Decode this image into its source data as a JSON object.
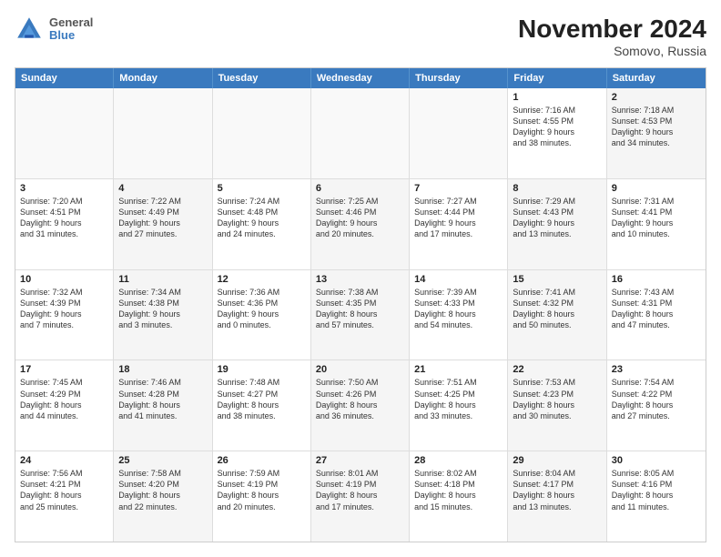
{
  "header": {
    "logo": {
      "line1": "General",
      "line2": "Blue"
    },
    "title": "November 2024",
    "subtitle": "Somovo, Russia"
  },
  "weekdays": [
    "Sunday",
    "Monday",
    "Tuesday",
    "Wednesday",
    "Thursday",
    "Friday",
    "Saturday"
  ],
  "rows": [
    [
      {
        "day": "",
        "info": "",
        "shaded": false,
        "empty": true
      },
      {
        "day": "",
        "info": "",
        "shaded": false,
        "empty": true
      },
      {
        "day": "",
        "info": "",
        "shaded": false,
        "empty": true
      },
      {
        "day": "",
        "info": "",
        "shaded": false,
        "empty": true
      },
      {
        "day": "",
        "info": "",
        "shaded": false,
        "empty": true
      },
      {
        "day": "1",
        "info": "Sunrise: 7:16 AM\nSunset: 4:55 PM\nDaylight: 9 hours\nand 38 minutes.",
        "shaded": false,
        "empty": false
      },
      {
        "day": "2",
        "info": "Sunrise: 7:18 AM\nSunset: 4:53 PM\nDaylight: 9 hours\nand 34 minutes.",
        "shaded": true,
        "empty": false
      }
    ],
    [
      {
        "day": "3",
        "info": "Sunrise: 7:20 AM\nSunset: 4:51 PM\nDaylight: 9 hours\nand 31 minutes.",
        "shaded": false,
        "empty": false
      },
      {
        "day": "4",
        "info": "Sunrise: 7:22 AM\nSunset: 4:49 PM\nDaylight: 9 hours\nand 27 minutes.",
        "shaded": true,
        "empty": false
      },
      {
        "day": "5",
        "info": "Sunrise: 7:24 AM\nSunset: 4:48 PM\nDaylight: 9 hours\nand 24 minutes.",
        "shaded": false,
        "empty": false
      },
      {
        "day": "6",
        "info": "Sunrise: 7:25 AM\nSunset: 4:46 PM\nDaylight: 9 hours\nand 20 minutes.",
        "shaded": true,
        "empty": false
      },
      {
        "day": "7",
        "info": "Sunrise: 7:27 AM\nSunset: 4:44 PM\nDaylight: 9 hours\nand 17 minutes.",
        "shaded": false,
        "empty": false
      },
      {
        "day": "8",
        "info": "Sunrise: 7:29 AM\nSunset: 4:43 PM\nDaylight: 9 hours\nand 13 minutes.",
        "shaded": true,
        "empty": false
      },
      {
        "day": "9",
        "info": "Sunrise: 7:31 AM\nSunset: 4:41 PM\nDaylight: 9 hours\nand 10 minutes.",
        "shaded": false,
        "empty": false
      }
    ],
    [
      {
        "day": "10",
        "info": "Sunrise: 7:32 AM\nSunset: 4:39 PM\nDaylight: 9 hours\nand 7 minutes.",
        "shaded": false,
        "empty": false
      },
      {
        "day": "11",
        "info": "Sunrise: 7:34 AM\nSunset: 4:38 PM\nDaylight: 9 hours\nand 3 minutes.",
        "shaded": true,
        "empty": false
      },
      {
        "day": "12",
        "info": "Sunrise: 7:36 AM\nSunset: 4:36 PM\nDaylight: 9 hours\nand 0 minutes.",
        "shaded": false,
        "empty": false
      },
      {
        "day": "13",
        "info": "Sunrise: 7:38 AM\nSunset: 4:35 PM\nDaylight: 8 hours\nand 57 minutes.",
        "shaded": true,
        "empty": false
      },
      {
        "day": "14",
        "info": "Sunrise: 7:39 AM\nSunset: 4:33 PM\nDaylight: 8 hours\nand 54 minutes.",
        "shaded": false,
        "empty": false
      },
      {
        "day": "15",
        "info": "Sunrise: 7:41 AM\nSunset: 4:32 PM\nDaylight: 8 hours\nand 50 minutes.",
        "shaded": true,
        "empty": false
      },
      {
        "day": "16",
        "info": "Sunrise: 7:43 AM\nSunset: 4:31 PM\nDaylight: 8 hours\nand 47 minutes.",
        "shaded": false,
        "empty": false
      }
    ],
    [
      {
        "day": "17",
        "info": "Sunrise: 7:45 AM\nSunset: 4:29 PM\nDaylight: 8 hours\nand 44 minutes.",
        "shaded": false,
        "empty": false
      },
      {
        "day": "18",
        "info": "Sunrise: 7:46 AM\nSunset: 4:28 PM\nDaylight: 8 hours\nand 41 minutes.",
        "shaded": true,
        "empty": false
      },
      {
        "day": "19",
        "info": "Sunrise: 7:48 AM\nSunset: 4:27 PM\nDaylight: 8 hours\nand 38 minutes.",
        "shaded": false,
        "empty": false
      },
      {
        "day": "20",
        "info": "Sunrise: 7:50 AM\nSunset: 4:26 PM\nDaylight: 8 hours\nand 36 minutes.",
        "shaded": true,
        "empty": false
      },
      {
        "day": "21",
        "info": "Sunrise: 7:51 AM\nSunset: 4:25 PM\nDaylight: 8 hours\nand 33 minutes.",
        "shaded": false,
        "empty": false
      },
      {
        "day": "22",
        "info": "Sunrise: 7:53 AM\nSunset: 4:23 PM\nDaylight: 8 hours\nand 30 minutes.",
        "shaded": true,
        "empty": false
      },
      {
        "day": "23",
        "info": "Sunrise: 7:54 AM\nSunset: 4:22 PM\nDaylight: 8 hours\nand 27 minutes.",
        "shaded": false,
        "empty": false
      }
    ],
    [
      {
        "day": "24",
        "info": "Sunrise: 7:56 AM\nSunset: 4:21 PM\nDaylight: 8 hours\nand 25 minutes.",
        "shaded": false,
        "empty": false
      },
      {
        "day": "25",
        "info": "Sunrise: 7:58 AM\nSunset: 4:20 PM\nDaylight: 8 hours\nand 22 minutes.",
        "shaded": true,
        "empty": false
      },
      {
        "day": "26",
        "info": "Sunrise: 7:59 AM\nSunset: 4:19 PM\nDaylight: 8 hours\nand 20 minutes.",
        "shaded": false,
        "empty": false
      },
      {
        "day": "27",
        "info": "Sunrise: 8:01 AM\nSunset: 4:19 PM\nDaylight: 8 hours\nand 17 minutes.",
        "shaded": true,
        "empty": false
      },
      {
        "day": "28",
        "info": "Sunrise: 8:02 AM\nSunset: 4:18 PM\nDaylight: 8 hours\nand 15 minutes.",
        "shaded": false,
        "empty": false
      },
      {
        "day": "29",
        "info": "Sunrise: 8:04 AM\nSunset: 4:17 PM\nDaylight: 8 hours\nand 13 minutes.",
        "shaded": true,
        "empty": false
      },
      {
        "day": "30",
        "info": "Sunrise: 8:05 AM\nSunset: 4:16 PM\nDaylight: 8 hours\nand 11 minutes.",
        "shaded": false,
        "empty": false
      }
    ]
  ]
}
